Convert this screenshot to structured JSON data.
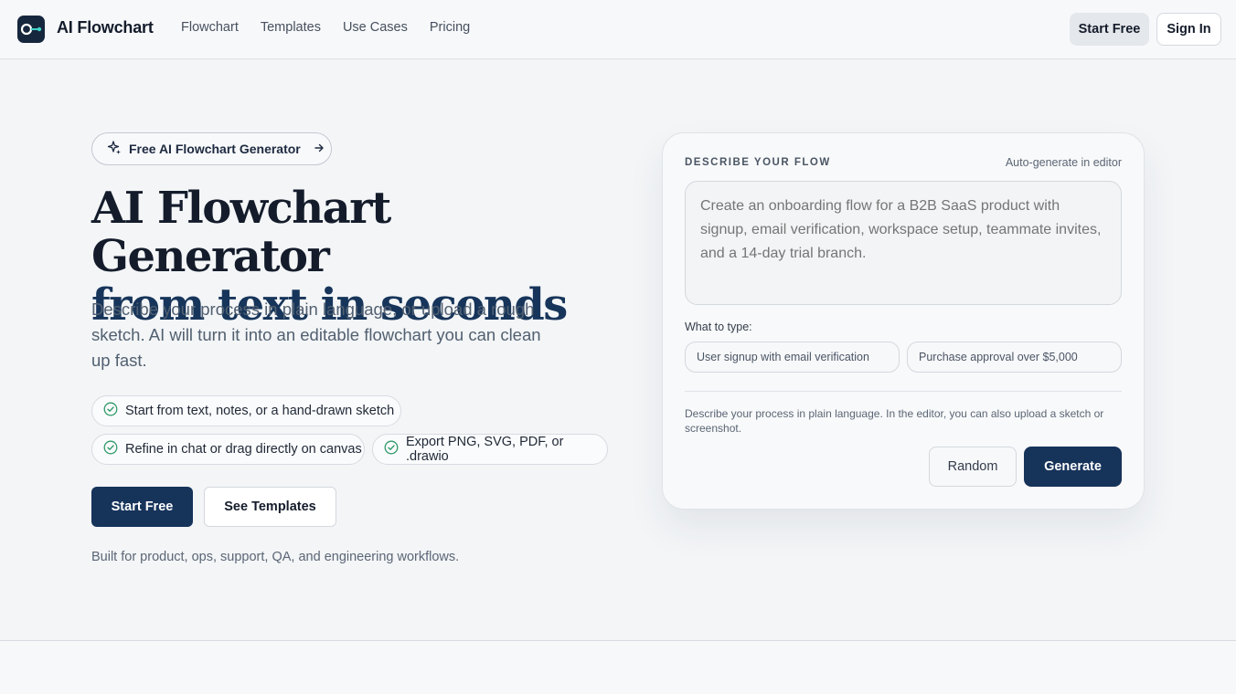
{
  "header": {
    "brand": "AI Flowchart",
    "nav": [
      "Flowchart",
      "Templates",
      "Use Cases",
      "Pricing"
    ],
    "start_free": "Start Free",
    "sign_in": "Sign In"
  },
  "hero": {
    "pill": "Free AI Flowchart Generator",
    "title_line1": "AI Flowchart Generator",
    "title_line2": "from text in seconds",
    "description": "Describe your process in plain language, or upload a rough sketch. AI will turn it into an editable flowchart you can clean up fast.",
    "features": [
      "Start from text, notes, or a hand-drawn sketch",
      "Refine in chat or drag directly on canvas",
      "Export PNG, SVG, PDF, or .drawio"
    ],
    "primary_cta": "Start Free",
    "secondary_cta": "See Templates",
    "built_for": "Built for product, ops, support, QA, and engineering workflows."
  },
  "card": {
    "label": "DESCRIBE YOUR FLOW",
    "hint": "Auto-generate in editor",
    "placeholder": "Create an onboarding flow for a B2B SaaS product with signup, email verification, workspace setup, teammate invites, and a 14-day trial branch.",
    "what_to_type": "What to type:",
    "suggestions": [
      "User signup with email verification",
      "Purchase approval over $5,000"
    ],
    "note": "Describe your process in plain language. In the editor, you can also upload a sketch or screenshot.",
    "random": "Random",
    "generate": "Generate"
  },
  "colors": {
    "brand_navy": "#16335a",
    "check_green": "#2f9a6a",
    "logo_accent": "#3fd3c9"
  }
}
